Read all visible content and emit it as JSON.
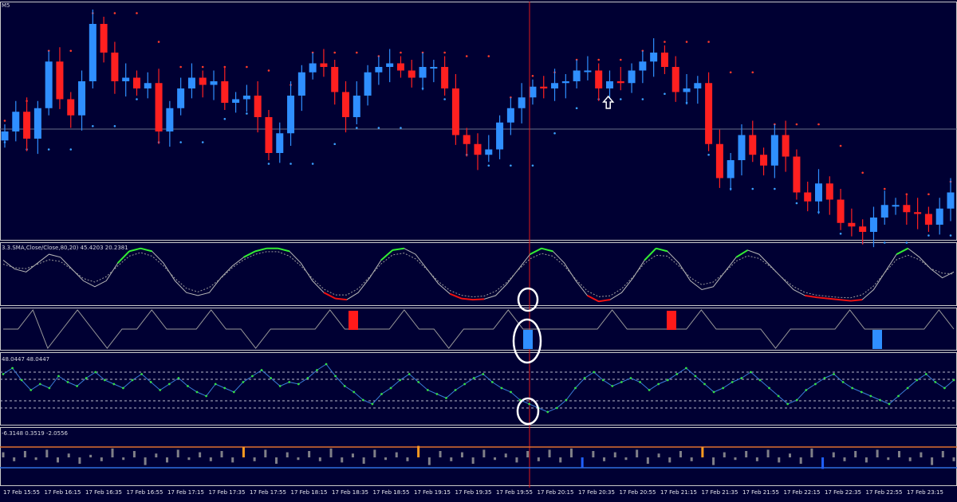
{
  "chart_data": [
    {
      "type": "candlestick",
      "panel": "main price",
      "label": "M5",
      "x": [
        "17 Feb 15:55",
        "17 Feb 16:15",
        "17 Feb 16:35",
        "17 Feb 16:55",
        "17 Feb 17:15",
        "17 Feb 17:35",
        "17 Feb 17:55",
        "17 Feb 18:15",
        "17 Feb 18:35",
        "17 Feb 18:55",
        "17 Feb 19:15",
        "17 Feb 19:35",
        "17 Feb 19:55",
        "17 Feb 20:15",
        "17 Feb 20:35",
        "17 Feb 20:55",
        "17 Feb 21:15",
        "17 Feb 21:35",
        "17 Feb 21:55",
        "17 Feb 22:15",
        "17 Feb 22:35",
        "17 Feb 22:55",
        "17 Feb 23:15"
      ],
      "close": [
        0.22,
        0.33,
        0.18,
        0.35,
        0.61,
        0.4,
        0.31,
        0.5,
        0.82,
        0.66,
        0.5,
        0.52,
        0.46,
        0.49,
        0.22,
        0.35,
        0.46,
        0.52,
        0.48,
        0.5,
        0.38,
        0.4,
        0.42,
        0.3,
        0.1,
        0.21,
        0.42,
        0.55,
        0.6,
        0.58,
        0.44,
        0.3,
        0.42,
        0.55,
        0.58,
        0.6,
        0.56,
        0.52,
        0.58,
        0.58,
        0.46,
        0.2,
        0.15,
        0.09,
        0.12,
        0.27,
        0.35,
        0.41,
        0.47,
        0.46,
        0.49,
        0.5,
        0.56,
        0.56,
        0.46,
        0.5,
        0.49,
        0.56,
        0.61,
        0.66,
        0.58,
        0.44,
        0.46,
        0.49,
        0.15,
        -0.04,
        0.06,
        0.2,
        0.09,
        0.03,
        0.2,
        0.08,
        -0.12,
        -0.17,
        -0.07,
        -0.16,
        -0.29,
        -0.31,
        -0.34,
        -0.26,
        -0.19,
        -0.19,
        -0.23,
        -0.24,
        -0.3,
        -0.21,
        -0.12
      ],
      "signal": {
        "type": "buy-arrow",
        "at_index": 54
      },
      "cursor": "17 Feb 20:00"
    },
    {
      "type": "line",
      "panel": "stochastic",
      "label": "3.3.SMA,Close/Close,80,20) 45.4203 20.2381",
      "series": [
        {
          "values": [
            75,
            60,
            55,
            70,
            85,
            80,
            60,
            40,
            30,
            40,
            70,
            90,
            95,
            90,
            70,
            40,
            20,
            15,
            20,
            45,
            65,
            80,
            90,
            95,
            95,
            90,
            70,
            40,
            20,
            10,
            8,
            20,
            45,
            75,
            92,
            95,
            85,
            60,
            35,
            18,
            10,
            8,
            9,
            15,
            35,
            60,
            85,
            95,
            90,
            70,
            40,
            15,
            5,
            8,
            20,
            45,
            75,
            95,
            90,
            70,
            40,
            25,
            30,
            55,
            80,
            92,
            85,
            65,
            45,
            25,
            15,
            12,
            10,
            8,
            6,
            8,
            25,
            55,
            85,
            95,
            80,
            60,
            45,
            55
          ]
        }
      ],
      "ylim": [
        0,
        100
      ]
    },
    {
      "type": "step",
      "panel": "signal",
      "series": [
        {
          "values": [
            0,
            0,
            1,
            -1,
            0,
            1,
            0,
            -1,
            0,
            0,
            1,
            0,
            0,
            0,
            1,
            0,
            0,
            -1,
            0,
            0,
            0,
            0,
            1,
            0,
            0,
            0,
            0,
            1,
            0,
            0,
            -1,
            0,
            0,
            0,
            1,
            0,
            0,
            0,
            0,
            0,
            0,
            1,
            0,
            0,
            0,
            0,
            0,
            1,
            0,
            0,
            0,
            0,
            -1,
            0,
            0,
            0,
            0,
            1,
            0,
            0,
            0,
            0,
            0,
            1,
            0
          ]
        }
      ],
      "markers": [
        {
          "color": "red"
        },
        {
          "color": "blue"
        },
        {
          "color": "red"
        },
        {
          "color": "blue"
        }
      ]
    },
    {
      "type": "line",
      "panel": "oscillator",
      "label": "48.0447 48.0447",
      "series": [
        {
          "values": [
            55,
            58,
            52,
            47,
            50,
            48,
            54,
            51,
            49,
            53,
            56,
            52,
            50,
            48,
            52,
            55,
            51,
            47,
            50,
            53,
            49,
            46,
            44,
            50,
            48,
            46,
            51,
            54,
            57,
            53,
            49,
            51,
            50,
            53,
            57,
            60,
            54,
            49,
            46,
            42,
            40,
            45,
            48,
            52,
            55,
            51,
            47,
            45,
            43,
            47,
            50,
            53,
            55,
            51,
            48,
            46,
            42,
            40,
            38,
            36,
            38,
            42,
            48,
            53,
            56,
            52,
            49,
            51,
            53,
            51,
            47,
            50,
            52,
            55,
            58,
            54,
            50,
            46,
            48,
            51,
            53,
            56,
            52,
            48,
            44,
            40,
            42,
            47,
            50,
            53,
            55,
            51,
            48,
            46,
            44,
            42,
            40,
            44,
            48,
            52,
            55,
            51,
            48,
            52
          ]
        }
      ]
    },
    {
      "type": "histogram",
      "panel": "volume oscillator",
      "label": "-6.3148 0.3519 -2.0556",
      "series": [
        {
          "values": [
            4,
            -3,
            5,
            -2,
            6,
            -4,
            3,
            -5,
            2,
            -3,
            7,
            -2,
            5,
            -6,
            3,
            -4,
            6,
            -2,
            4,
            -3,
            5,
            -4,
            8,
            -3,
            6,
            -5,
            4,
            -2,
            5,
            -3,
            7,
            -4,
            3,
            -5,
            6,
            -2,
            4,
            -3,
            9,
            -6,
            5,
            -3,
            4,
            -5,
            6,
            -2,
            3,
            -4,
            5,
            -3,
            6,
            -4,
            7,
            -8,
            5,
            -3,
            4,
            -2,
            6,
            -5,
            3,
            -4,
            5,
            -3,
            8,
            -6,
            4,
            -2,
            5,
            -3,
            6,
            -4,
            3,
            -5,
            7,
            -9,
            4,
            -3,
            5,
            -4,
            6,
            -2,
            5,
            -3,
            4,
            -6,
            5,
            -3
          ]
        }
      ]
    }
  ]
}
